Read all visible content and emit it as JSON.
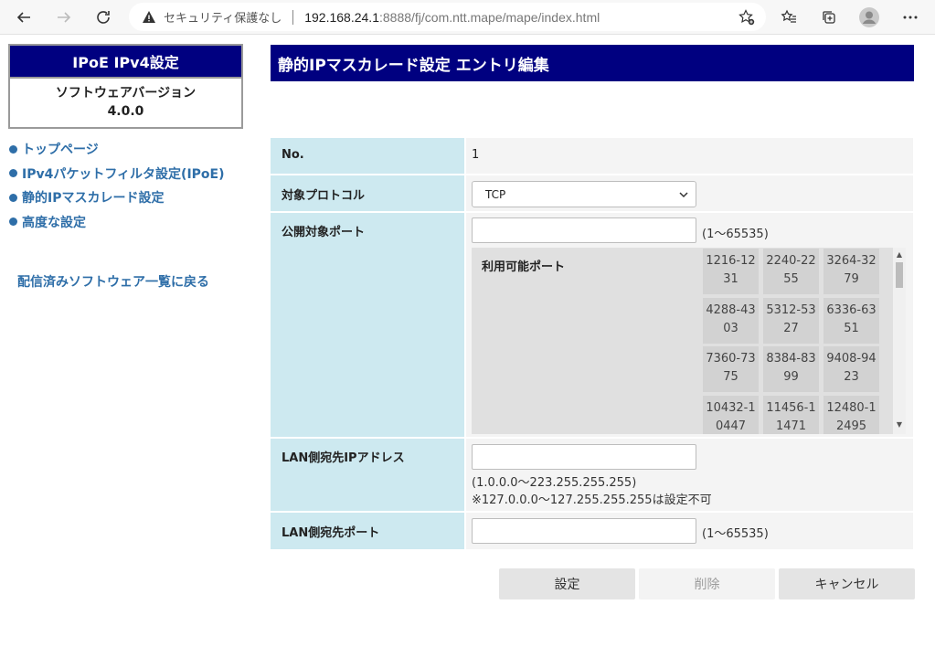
{
  "browser": {
    "security_text": "セキュリティ保護なし",
    "url_host": "192.168.24.1",
    "url_path": ":8888/fj/com.ntt.mape/mape/index.html"
  },
  "sidebar": {
    "title": "IPoE IPv4設定",
    "version_label": "ソフトウェアバージョン",
    "version": "4.0.0",
    "nav": [
      {
        "label": "トップページ"
      },
      {
        "label": "IPv4パケットフィルタ設定(IPoE)"
      },
      {
        "label": "静的IPマスカレード設定"
      },
      {
        "label": "高度な設定"
      }
    ],
    "back_link": "配信済みソフトウェア一覧に戻る"
  },
  "main": {
    "title": "静的IPマスカレード設定 エントリ編集",
    "rows": {
      "no_label": "No.",
      "no_value": "1",
      "protocol_label": "対象プロトコル",
      "protocol_value": "TCP",
      "public_port_label": "公開対象ポート",
      "public_port_range": "(1～65535)",
      "available_ports_label": "利用可能ポート",
      "lan_ip_label": "LAN側宛先IPアドレス",
      "lan_ip_range": "(1.0.0.0～223.255.255.255)",
      "lan_ip_note": "※127.0.0.0～127.255.255.255は設定不可",
      "lan_port_label": "LAN側宛先ポート",
      "lan_port_range": "(1～65535)"
    },
    "available_ports": [
      [
        "1216-12",
        "31"
      ],
      [
        "2240-22",
        "55"
      ],
      [
        "3264-32",
        "79"
      ],
      [
        "4288-43",
        "03"
      ],
      [
        "5312-53",
        "27"
      ],
      [
        "6336-63",
        "51"
      ],
      [
        "7360-73",
        "75"
      ],
      [
        "8384-83",
        "99"
      ],
      [
        "9408-94",
        "23"
      ],
      [
        "10432-1",
        "0447"
      ],
      [
        "11456-1",
        "1471"
      ],
      [
        "12480-1",
        "2495"
      ]
    ],
    "buttons": {
      "set": "設定",
      "delete": "削除",
      "cancel": "キャンセル"
    }
  }
}
